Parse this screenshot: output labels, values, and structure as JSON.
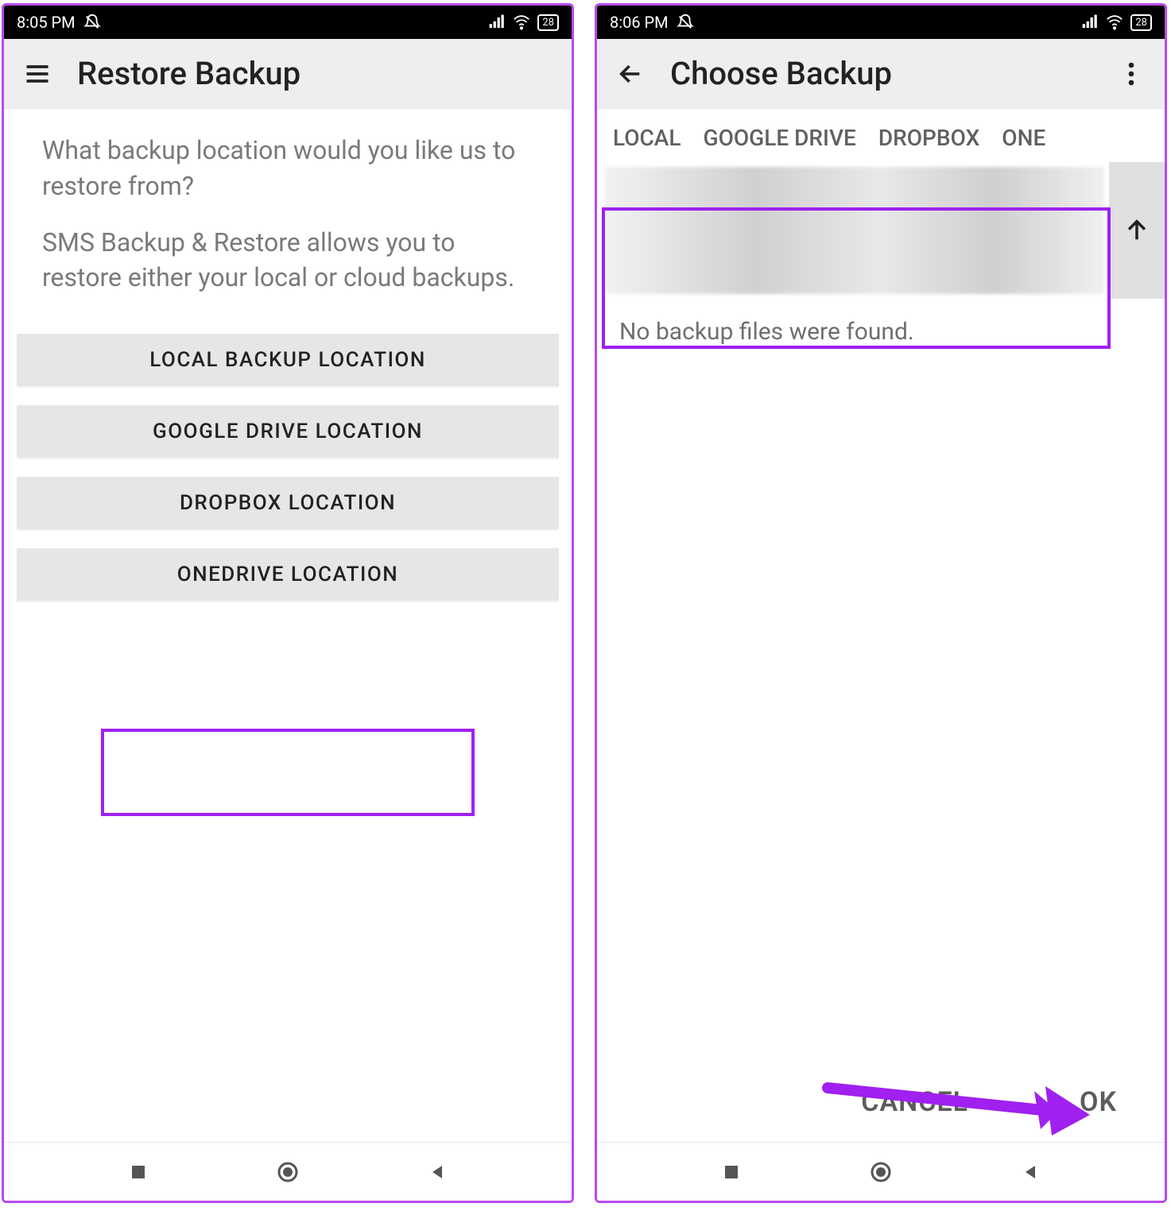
{
  "status": {
    "battery": "28"
  },
  "left": {
    "time": "8:05 PM",
    "appbar_title": "Restore Backup",
    "desc1": "What backup location would you like us to restore from?",
    "desc2": "SMS Backup & Restore allows you to restore either your local or cloud backups.",
    "buttons": {
      "local": "LOCAL BACKUP LOCATION",
      "gdrive": "GOOGLE DRIVE LOCATION",
      "dropbox": "DROPBOX LOCATION",
      "onedrive": "ONEDRIVE LOCATION"
    }
  },
  "right": {
    "time": "8:06 PM",
    "appbar_title": "Choose Backup",
    "tabs": {
      "local": "LOCAL",
      "gdrive": "GOOGLE DRIVE",
      "dropbox": "DROPBOX",
      "onedrive": "ONE"
    },
    "empty_msg": "No backup files were found.",
    "actions": {
      "cancel": "CANCEL",
      "ok": "OK"
    }
  }
}
